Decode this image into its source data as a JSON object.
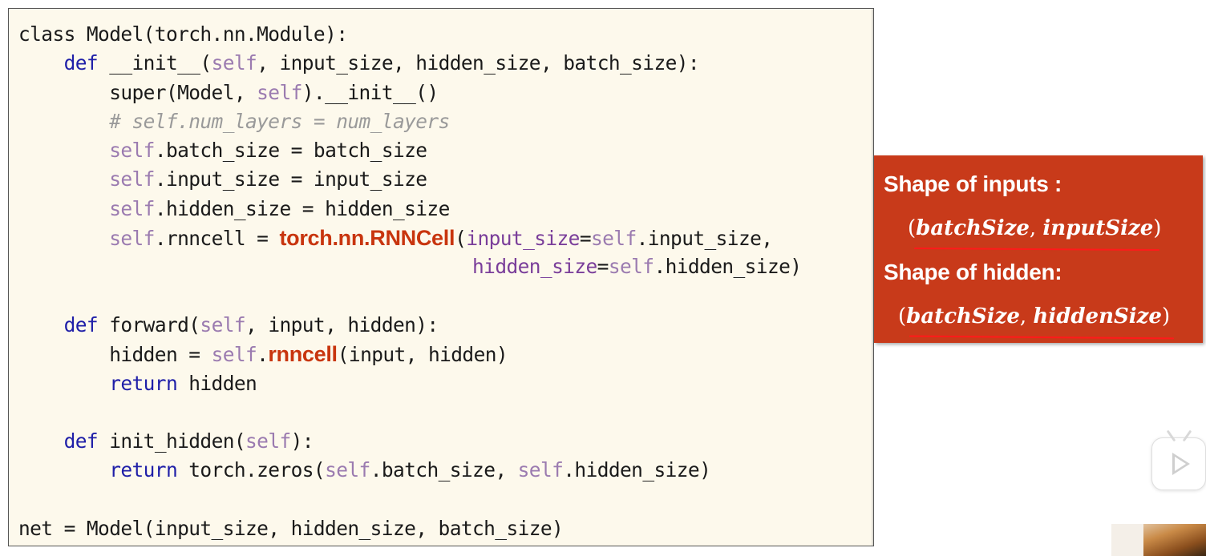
{
  "code_lines": [
    [
      {
        "t": "class Model(torch.nn.Module):"
      }
    ],
    [
      {
        "t": "    "
      },
      {
        "t": "def",
        "c": "kw"
      },
      {
        "t": " __init__(",
        "c": ""
      },
      {
        "t": "self",
        "c": "self"
      },
      {
        "t": ", input_size, hidden_size, batch_size):"
      }
    ],
    [
      {
        "t": "        super(Model, "
      },
      {
        "t": "self",
        "c": "self"
      },
      {
        "t": ").__init__()"
      }
    ],
    [
      {
        "t": "        "
      },
      {
        "t": "# self.num_layers = num_layers",
        "c": "cm"
      }
    ],
    [
      {
        "t": "        "
      },
      {
        "t": "self",
        "c": "self"
      },
      {
        "t": ".batch_size = batch_size"
      }
    ],
    [
      {
        "t": "        "
      },
      {
        "t": "self",
        "c": "self"
      },
      {
        "t": ".input_size = input_size"
      }
    ],
    [
      {
        "t": "        "
      },
      {
        "t": "self",
        "c": "self"
      },
      {
        "t": ".hidden_size = hidden_size"
      }
    ],
    [
      {
        "t": "        "
      },
      {
        "t": "self",
        "c": "self"
      },
      {
        "t": ".rnncell = "
      },
      {
        "t": "torch.nn.RNNCell",
        "c": "hl"
      },
      {
        "t": "("
      },
      {
        "t": "input_size",
        "c": "pm"
      },
      {
        "t": "="
      },
      {
        "t": "self",
        "c": "self"
      },
      {
        "t": ".input_size,"
      }
    ],
    [
      {
        "t": "                                        "
      },
      {
        "t": "hidden_size",
        "c": "pm"
      },
      {
        "t": "="
      },
      {
        "t": "self",
        "c": "self"
      },
      {
        "t": ".hidden_size)"
      }
    ],
    [
      {
        "t": ""
      }
    ],
    [
      {
        "t": "    "
      },
      {
        "t": "def",
        "c": "kw"
      },
      {
        "t": " forward("
      },
      {
        "t": "self",
        "c": "self"
      },
      {
        "t": ", input, hidden):"
      }
    ],
    [
      {
        "t": "        hidden = "
      },
      {
        "t": "self",
        "c": "self"
      },
      {
        "t": "."
      },
      {
        "t": "rnncell",
        "c": "hl"
      },
      {
        "t": "(input, hidden)"
      }
    ],
    [
      {
        "t": "        "
      },
      {
        "t": "return",
        "c": "kw"
      },
      {
        "t": " hidden"
      }
    ],
    [
      {
        "t": ""
      }
    ],
    [
      {
        "t": "    "
      },
      {
        "t": "def",
        "c": "kw"
      },
      {
        "t": " init_hidden("
      },
      {
        "t": "self",
        "c": "self"
      },
      {
        "t": "):"
      }
    ],
    [
      {
        "t": "        "
      },
      {
        "t": "return",
        "c": "kw"
      },
      {
        "t": " torch.zeros("
      },
      {
        "t": "self",
        "c": "self"
      },
      {
        "t": ".batch_size, "
      },
      {
        "t": "self",
        "c": "self"
      },
      {
        "t": ".hidden_size)"
      }
    ],
    [
      {
        "t": ""
      }
    ],
    [
      {
        "t": "net = Model(input_size, hidden_size, batch_size)"
      }
    ]
  ],
  "shape_panel": {
    "inputs_title": "Shape of inputs :",
    "inputs_open": "(",
    "inputs_a": "batchSize",
    "inputs_sep": ", ",
    "inputs_b": "inputSize",
    "inputs_close": ")",
    "hidden_title": "Shape of hidden:",
    "hidden_open": "(",
    "hidden_a": "batchSize",
    "hidden_sep": ", ",
    "hidden_b": "hiddenSize",
    "hidden_close": ")",
    "panel_color": "#c83a1a",
    "underline_color": "#ff1a1a"
  },
  "colors": {
    "code_background": "#fdf9ec",
    "keyword": "#1f1fa8",
    "self": "#9b7bb0",
    "comment": "#9a9a9a",
    "param": "#7a3e9a",
    "highlight": "#c8350e"
  },
  "overlay": {
    "play_icon": "play-icon"
  }
}
